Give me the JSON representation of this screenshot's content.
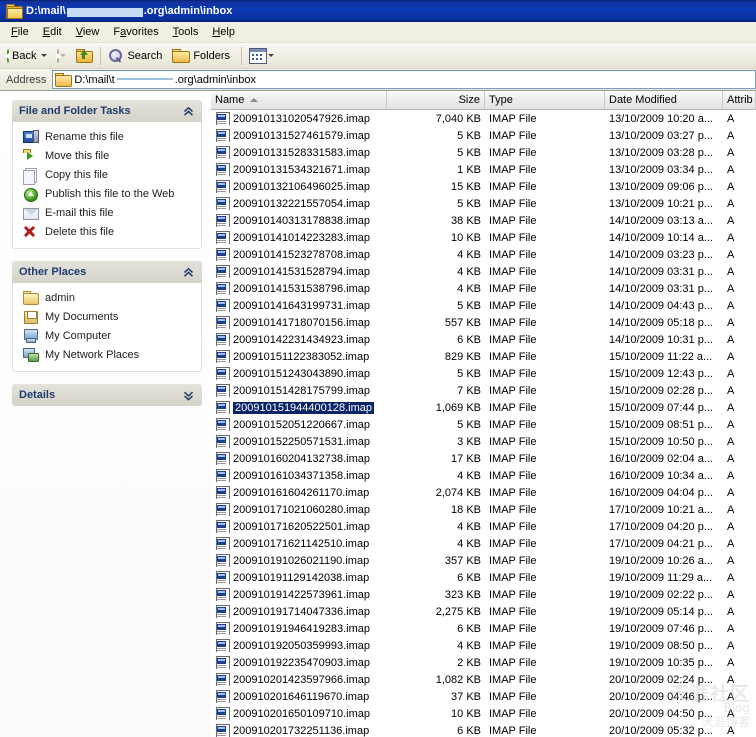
{
  "window": {
    "title_prefix": "D:\\mail\\",
    "title_suffix": ".org\\admin\\inbox",
    "icon": "folder-icon"
  },
  "menu": {
    "items": [
      {
        "label": "File",
        "accel": "F"
      },
      {
        "label": "Edit",
        "accel": "E"
      },
      {
        "label": "View",
        "accel": "V"
      },
      {
        "label": "Favorites",
        "accel": "a"
      },
      {
        "label": "Tools",
        "accel": "T"
      },
      {
        "label": "Help",
        "accel": "H"
      }
    ]
  },
  "toolbar": {
    "back_label": "Back",
    "forward_label": "",
    "up_label": "",
    "search_label": "Search",
    "folders_label": "Folders",
    "views_label": ""
  },
  "address": {
    "label": "Address",
    "path_prefix": "D:\\mail\\t",
    "path_suffix": ".org\\admin\\inbox"
  },
  "sidebar": {
    "panels": [
      {
        "title": "File and Folder Tasks",
        "collapsed": false,
        "chevron": "chevron-up-icon",
        "items": [
          {
            "label": "Rename this file",
            "icon": "rename-icon"
          },
          {
            "label": "Move this file",
            "icon": "move-icon"
          },
          {
            "label": "Copy this file",
            "icon": "copy-icon"
          },
          {
            "label": "Publish this file to the Web",
            "icon": "publish-globe-icon"
          },
          {
            "label": "E-mail this file",
            "icon": "email-icon"
          },
          {
            "label": "Delete this file",
            "icon": "delete-x-icon"
          }
        ]
      },
      {
        "title": "Other Places",
        "collapsed": false,
        "chevron": "chevron-up-icon",
        "items": [
          {
            "label": "admin",
            "icon": "folder-icon"
          },
          {
            "label": "My Documents",
            "icon": "my-documents-icon"
          },
          {
            "label": "My Computer",
            "icon": "my-computer-icon"
          },
          {
            "label": "My Network Places",
            "icon": "network-places-icon"
          }
        ]
      },
      {
        "title": "Details",
        "collapsed": true,
        "chevron": "chevron-down-icon",
        "items": []
      }
    ]
  },
  "filelist": {
    "columns": [
      {
        "label": "Name",
        "sorted": true,
        "sort_dir": "asc",
        "align": "left"
      },
      {
        "label": "Size",
        "sorted": false,
        "align": "right"
      },
      {
        "label": "Type",
        "sorted": false,
        "align": "left"
      },
      {
        "label": "Date Modified",
        "sorted": false,
        "align": "left"
      },
      {
        "label": "Attrib",
        "sorted": false,
        "align": "left"
      }
    ],
    "selected_index": 17,
    "rows": [
      {
        "name": "200910131020547926.imap",
        "size": "7,040 KB",
        "type": "IMAP File",
        "date": "13/10/2009 10:20 a...",
        "attrib": "A"
      },
      {
        "name": "200910131527461579.imap",
        "size": "5 KB",
        "type": "IMAP File",
        "date": "13/10/2009 03:27 p...",
        "attrib": "A"
      },
      {
        "name": "200910131528331583.imap",
        "size": "5 KB",
        "type": "IMAP File",
        "date": "13/10/2009 03:28 p...",
        "attrib": "A"
      },
      {
        "name": "200910131534321671.imap",
        "size": "1 KB",
        "type": "IMAP File",
        "date": "13/10/2009 03:34 p...",
        "attrib": "A"
      },
      {
        "name": "200910132106496025.imap",
        "size": "15 KB",
        "type": "IMAP File",
        "date": "13/10/2009 09:06 p...",
        "attrib": "A"
      },
      {
        "name": "200910132221557054.imap",
        "size": "5 KB",
        "type": "IMAP File",
        "date": "13/10/2009 10:21 p...",
        "attrib": "A"
      },
      {
        "name": "200910140313178838.imap",
        "size": "38 KB",
        "type": "IMAP File",
        "date": "14/10/2009 03:13 a...",
        "attrib": "A"
      },
      {
        "name": "200910141014223283.imap",
        "size": "10 KB",
        "type": "IMAP File",
        "date": "14/10/2009 10:14 a...",
        "attrib": "A"
      },
      {
        "name": "200910141523278708.imap",
        "size": "4 KB",
        "type": "IMAP File",
        "date": "14/10/2009 03:23 p...",
        "attrib": "A"
      },
      {
        "name": "200910141531528794.imap",
        "size": "4 KB",
        "type": "IMAP File",
        "date": "14/10/2009 03:31 p...",
        "attrib": "A"
      },
      {
        "name": "200910141531538796.imap",
        "size": "4 KB",
        "type": "IMAP File",
        "date": "14/10/2009 03:31 p...",
        "attrib": "A"
      },
      {
        "name": "200910141643199731.imap",
        "size": "5 KB",
        "type": "IMAP File",
        "date": "14/10/2009 04:43 p...",
        "attrib": "A"
      },
      {
        "name": "200910141718070156.imap",
        "size": "557 KB",
        "type": "IMAP File",
        "date": "14/10/2009 05:18 p...",
        "attrib": "A"
      },
      {
        "name": "200910142231434923.imap",
        "size": "6 KB",
        "type": "IMAP File",
        "date": "14/10/2009 10:31 p...",
        "attrib": "A"
      },
      {
        "name": "200910151122383052.imap",
        "size": "829 KB",
        "type": "IMAP File",
        "date": "15/10/2009 11:22 a...",
        "attrib": "A"
      },
      {
        "name": "200910151243043890.imap",
        "size": "5 KB",
        "type": "IMAP File",
        "date": "15/10/2009 12:43 p...",
        "attrib": "A"
      },
      {
        "name": "200910151428175799.imap",
        "size": "7 KB",
        "type": "IMAP File",
        "date": "15/10/2009 02:28 p...",
        "attrib": "A"
      },
      {
        "name": "200910151944400128.imap",
        "size": "1,069 KB",
        "type": "IMAP File",
        "date": "15/10/2009 07:44 p...",
        "attrib": "A"
      },
      {
        "name": "200910152051220667.imap",
        "size": "5 KB",
        "type": "IMAP File",
        "date": "15/10/2009 08:51 p...",
        "attrib": "A"
      },
      {
        "name": "200910152250571531.imap",
        "size": "3 KB",
        "type": "IMAP File",
        "date": "15/10/2009 10:50 p...",
        "attrib": "A"
      },
      {
        "name": "200910160204132738.imap",
        "size": "17 KB",
        "type": "IMAP File",
        "date": "16/10/2009 02:04 a...",
        "attrib": "A"
      },
      {
        "name": "200910161034371358.imap",
        "size": "4 KB",
        "type": "IMAP File",
        "date": "16/10/2009 10:34 a...",
        "attrib": "A"
      },
      {
        "name": "200910161604261170.imap",
        "size": "2,074 KB",
        "type": "IMAP File",
        "date": "16/10/2009 04:04 p...",
        "attrib": "A"
      },
      {
        "name": "200910171021060280.imap",
        "size": "18 KB",
        "type": "IMAP File",
        "date": "17/10/2009 10:21 a...",
        "attrib": "A"
      },
      {
        "name": "200910171620522501.imap",
        "size": "4 KB",
        "type": "IMAP File",
        "date": "17/10/2009 04:20 p...",
        "attrib": "A"
      },
      {
        "name": "200910171621142510.imap",
        "size": "4 KB",
        "type": "IMAP File",
        "date": "17/10/2009 04:21 p...",
        "attrib": "A"
      },
      {
        "name": "200910191026021190.imap",
        "size": "357 KB",
        "type": "IMAP File",
        "date": "19/10/2009 10:26 a...",
        "attrib": "A"
      },
      {
        "name": "200910191129142038.imap",
        "size": "6 KB",
        "type": "IMAP File",
        "date": "19/10/2009 11:29 a...",
        "attrib": "A"
      },
      {
        "name": "200910191422573961.imap",
        "size": "323 KB",
        "type": "IMAP File",
        "date": "19/10/2009 02:22 p...",
        "attrib": "A"
      },
      {
        "name": "200910191714047336.imap",
        "size": "2,275 KB",
        "type": "IMAP File",
        "date": "19/10/2009 05:14 p...",
        "attrib": "A"
      },
      {
        "name": "200910191946419283.imap",
        "size": "6 KB",
        "type": "IMAP File",
        "date": "19/10/2009 07:46 p...",
        "attrib": "A"
      },
      {
        "name": "200910192050359993.imap",
        "size": "4 KB",
        "type": "IMAP File",
        "date": "19/10/2009 08:50 p...",
        "attrib": "A"
      },
      {
        "name": "200910192235470903.imap",
        "size": "2 KB",
        "type": "IMAP File",
        "date": "19/10/2009 10:35 p...",
        "attrib": "A"
      },
      {
        "name": "200910201423597966.imap",
        "size": "1,082 KB",
        "type": "IMAP File",
        "date": "20/10/2009 02:24 p...",
        "attrib": "A"
      },
      {
        "name": "200910201646119670.imap",
        "size": "37 KB",
        "type": "IMAP File",
        "date": "20/10/2009 04:46 p...",
        "attrib": "A"
      },
      {
        "name": "200910201650109710.imap",
        "size": "10 KB",
        "type": "IMAP File",
        "date": "20/10/2009 04:50 p...",
        "attrib": "A"
      },
      {
        "name": "200910201732251136.imap",
        "size": "6 KB",
        "type": "IMAP File",
        "date": "20/10/2009 05:32 p...",
        "attrib": "A"
      }
    ]
  },
  "watermark": {
    "line1": "天涯社区",
    "line2": "Blog",
    "line3": "天涯博客"
  },
  "colors": {
    "title_bar": "#0a246a",
    "selection": "#0a246a",
    "panel_header_text": "#1f3b6e",
    "toolbar_bg": "#efedE1"
  }
}
